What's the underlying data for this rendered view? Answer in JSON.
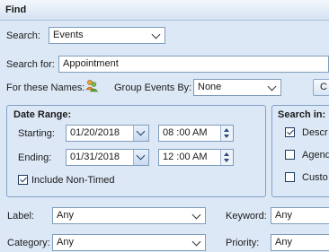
{
  "window": {
    "title": "Find"
  },
  "search": {
    "label": "Search:",
    "value": "Events"
  },
  "search_for": {
    "label": "Search for:",
    "value": "Appointment"
  },
  "names": {
    "label": "For these Names:"
  },
  "group_events": {
    "label": "Group Events By:",
    "value": "None"
  },
  "clear_button": {
    "label": "C"
  },
  "date_range": {
    "title": "Date Range:",
    "starting_label": "Starting:",
    "starting_date": "01/20/2018",
    "starting_time": "08 :00  AM",
    "ending_label": "Ending:",
    "ending_date": "01/31/2018",
    "ending_time": "12 :00  AM",
    "include_non_timed": "Include Non-Timed",
    "include_non_timed_checked": true
  },
  "search_in": {
    "title": "Search in:",
    "options": [
      {
        "label": "Descr",
        "checked": true
      },
      {
        "label": "Agend",
        "checked": false
      },
      {
        "label": "Custo",
        "checked": false
      }
    ]
  },
  "label_field": {
    "label": "Label:",
    "value": "Any"
  },
  "keyword_field": {
    "label": "Keyword:",
    "value": "Any"
  },
  "category_field": {
    "label": "Category:",
    "value": "Any"
  },
  "priority_field": {
    "label": "Priority:",
    "value": "Any"
  }
}
